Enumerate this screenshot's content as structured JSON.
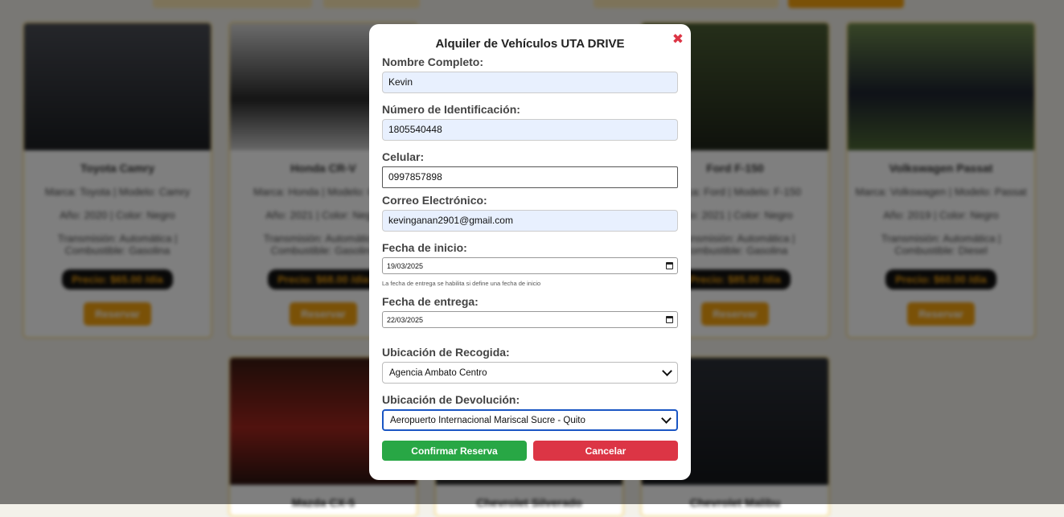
{
  "modal": {
    "title": "Alquiler de Vehículos UTA DRIVE",
    "close_symbol": "✖",
    "nombre": {
      "label": "Nombre Completo:",
      "value": "Kevin"
    },
    "identificacion": {
      "label": "Número de Identificación:",
      "value": "1805540448"
    },
    "celular": {
      "label": "Celular:",
      "value": "0997857898"
    },
    "correo": {
      "label": "Correo Electrónico:",
      "value": "kevinganan2901@gmail.com"
    },
    "fecha_inicio": {
      "label": "Fecha de inicio:",
      "value": "19/03/2025"
    },
    "hint": "La fecha de entrega se habilita si define una fecha de inicio",
    "fecha_entrega": {
      "label": "Fecha de entrega:",
      "value": "22/03/2025"
    },
    "recogida": {
      "label": "Ubicación de Recogida:",
      "selected": "Agencia Ambato Centro"
    },
    "devolucion": {
      "label": "Ubicación de Devolución:",
      "selected": "Aeropuerto Internacional Mariscal Sucre - Quito"
    },
    "confirm_label": "Confirmar Reserva",
    "cancel_label": "Cancelar"
  },
  "background_cards": [
    {
      "name": "Toyota Camry",
      "line1": "Marca: Toyota | Modelo: Camry",
      "line2": "Año: 2020 | Color: Negro",
      "line3": "Transmisión: Automática | Combustible: Gasolina",
      "price": "Precio: $65.00 /día",
      "button": "Reservar",
      "image_color": "#2b2d33"
    },
    {
      "name": "Honda CR-V",
      "line1": "Marca: Honda | Modelo: CR-V",
      "line2": "Año: 2021 | Color: Negro",
      "line3": "Transmisión: Automática | Combustible: Gasolina",
      "price": "Precio: $68.00 /día",
      "button": "Reservar",
      "image_color": "#3a3a3a"
    },
    {
      "name": "Ford F-150",
      "line1": "Marca: Ford | Modelo: F-150",
      "line2": "Año: 2021 | Color: Negro",
      "line3": "Transmisión: Automática | Combustible: Gasolina",
      "price": "Precio: $85.00 /día",
      "button": "Reservar",
      "image_color": "#2f3b24"
    },
    {
      "name": "Volkswagen Passat",
      "line1": "Marca: Volkswagen | Modelo: Passat",
      "line2": "Año: 2019 | Color: Negro",
      "line3": "Transmisión: Automática | Combustible: Diesel",
      "price": "Precio: $60.00 /día",
      "button": "Reservar",
      "image_color": "#4a5a3c"
    },
    {
      "name": "Mazda CX-5",
      "image_color": "#5c1f1a"
    },
    {
      "name": "Chevrolet Silverado",
      "image_color": "#3a3a3a"
    },
    {
      "name": "Chevrolet Malibu",
      "image_color": "#22262c"
    }
  ],
  "colors": {
    "accent": "#f5a20e",
    "confirm": "#28a745",
    "cancel": "#dc3545",
    "close": "#dc3545"
  }
}
